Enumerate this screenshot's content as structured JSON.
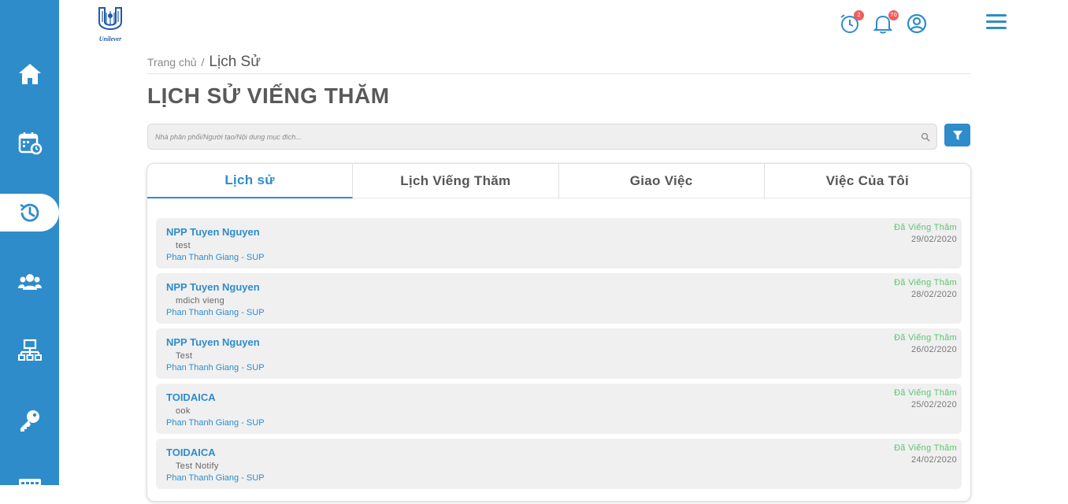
{
  "brand": {
    "logo_text": "Unilever"
  },
  "header": {
    "alarm_badge": "2",
    "notification_badge": "70"
  },
  "breadcrumb": {
    "home": "Trang chủ",
    "separator": "/",
    "current": "Lịch Sử"
  },
  "page_title": "LỊCH SỬ VIẾNG THĂM",
  "search": {
    "placeholder": "Nhà phân phối/Người tạo/Nội dung mục đích..."
  },
  "tabs": [
    {
      "label": "Lịch sử",
      "active": true
    },
    {
      "label": "Lịch Viếng Thăm",
      "active": false
    },
    {
      "label": "Giao Việc",
      "active": false
    },
    {
      "label": "Việc Của Tôi",
      "active": false
    }
  ],
  "sidebar": {
    "items": [
      {
        "icon": "home-icon"
      },
      {
        "icon": "calendar-clock-icon"
      },
      {
        "icon": "history-icon",
        "active": true
      },
      {
        "icon": "users-icon"
      },
      {
        "icon": "network-icon"
      },
      {
        "icon": "key-icon"
      },
      {
        "icon": "keyboard-icon"
      }
    ]
  },
  "visits": [
    {
      "title": "NPP Tuyen Nguyen",
      "desc": "test",
      "creator": "Phan Thanh Giang - SUP",
      "status": "Đã Viếng Thăm",
      "date": "29/02/2020"
    },
    {
      "title": "NPP Tuyen Nguyen",
      "desc": "mdich vieng",
      "creator": "Phan Thanh Giang - SUP",
      "status": "Đã Viếng Thăm",
      "date": "28/02/2020"
    },
    {
      "title": "NPP Tuyen Nguyen",
      "desc": "Test",
      "creator": "Phan Thanh Giang - SUP",
      "status": "Đã Viếng Thăm",
      "date": "26/02/2020"
    },
    {
      "title": "TOIDAICA",
      "desc": "ook",
      "creator": "Phan Thanh Giang - SUP",
      "status": "Đã Viếng Thăm",
      "date": "25/02/2020"
    },
    {
      "title": "TOIDAICA",
      "desc": "Test Notify",
      "creator": "Phan Thanh Giang - SUP",
      "status": "Đã Viếng Thăm",
      "date": "24/02/2020"
    }
  ],
  "colors": {
    "primary": "#2e8ccb",
    "status_green": "#5cc46f",
    "badge_red": "#f25c5c"
  }
}
